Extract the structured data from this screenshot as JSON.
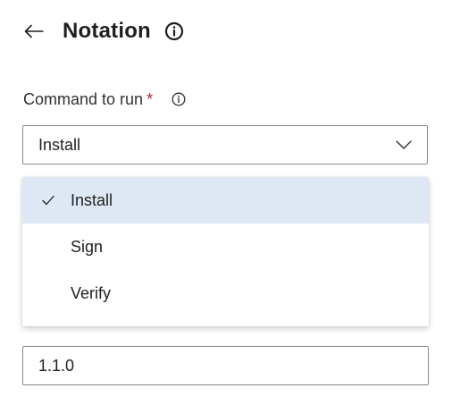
{
  "header": {
    "title": "Notation",
    "back_icon": "arrow-left-icon",
    "info_icon": "info-icon"
  },
  "command_field": {
    "label": "Command to run",
    "required_mark": "*",
    "info_icon": "info-icon",
    "selected_value": "Install",
    "chevron_icon": "chevron-down-icon",
    "options": [
      {
        "label": "Install",
        "selected": true
      },
      {
        "label": "Sign",
        "selected": false
      },
      {
        "label": "Verify",
        "selected": false
      }
    ]
  },
  "version_field": {
    "value": "1.1.0"
  },
  "colors": {
    "selected_bg": "#dee8f5",
    "required": "#a4262c",
    "border": "#8a8886",
    "text": "#201f1e"
  }
}
